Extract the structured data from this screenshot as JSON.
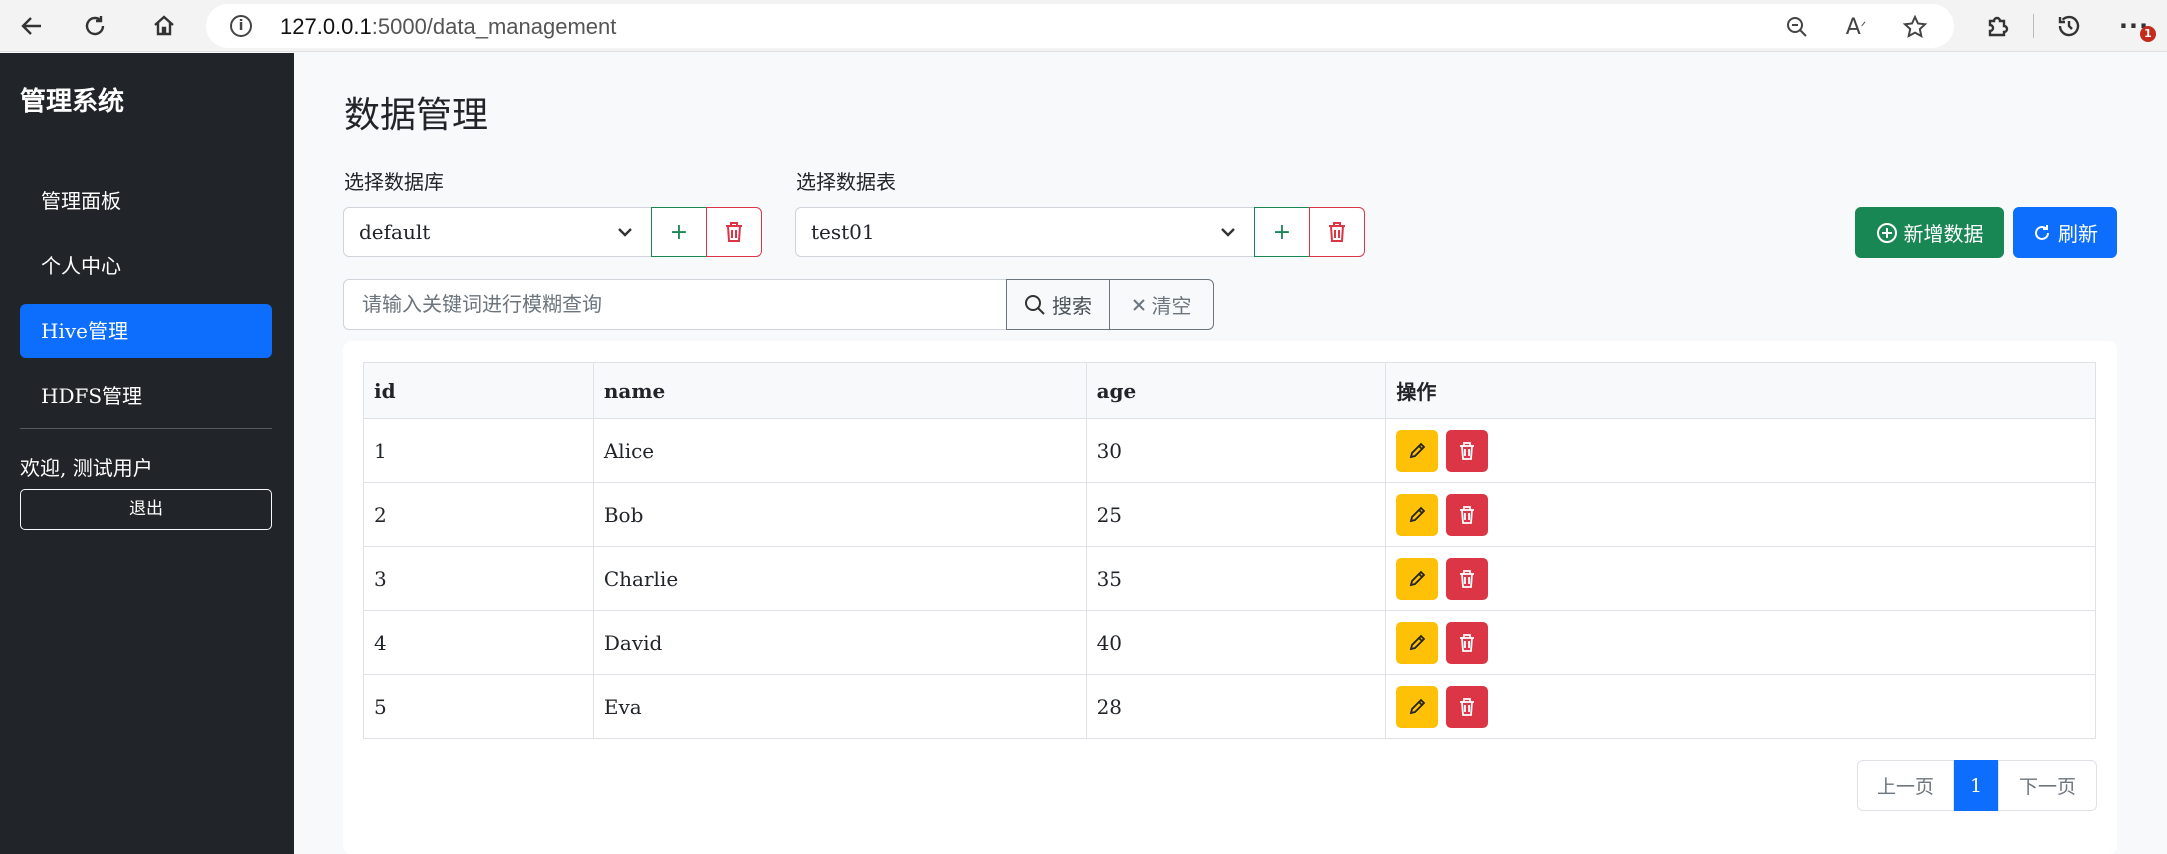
{
  "browser": {
    "url_host": "127.0.0.1",
    "url_rest": ":5000/data_management",
    "notification_count": "1"
  },
  "sidebar": {
    "brand": "管理系统",
    "items": [
      {
        "label": "管理面板",
        "active": false
      },
      {
        "label": "个人中心",
        "active": false
      },
      {
        "label": "Hive管理",
        "active": true
      },
      {
        "label": "HDFS管理",
        "active": false
      }
    ],
    "welcome": "欢迎, 测试用户",
    "logout": "退出"
  },
  "main": {
    "title": "数据管理",
    "database_label": "选择数据库",
    "database_value": "default",
    "table_label": "选择数据表",
    "table_value": "test01",
    "add_symbol": "+",
    "add_data_button": "新增数据",
    "refresh_button": "刷新",
    "search_placeholder": "请输入关键词进行模糊查询",
    "search_button": "搜索",
    "clear_button": "清空"
  },
  "table": {
    "columns": [
      "id",
      "name",
      "age",
      "操作"
    ],
    "rows": [
      [
        "1",
        "Alice",
        "30"
      ],
      [
        "2",
        "Bob",
        "25"
      ],
      [
        "3",
        "Charlie",
        "35"
      ],
      [
        "4",
        "David",
        "40"
      ],
      [
        "5",
        "Eva",
        "28"
      ]
    ]
  },
  "pagination": {
    "prev": "上一页",
    "current": "1",
    "next": "下一页"
  },
  "colors": {
    "sidebar_bg": "#212529",
    "primary": "#0d6efd",
    "success": "#198754",
    "danger": "#dc3545",
    "warning": "#ffc107"
  },
  "icons": [
    "back-arrow-icon",
    "reload-icon",
    "home-icon",
    "info-icon",
    "zoom-out-icon",
    "read-aloud-icon",
    "favorite-star-icon",
    "extensions-icon",
    "history-icon",
    "more-icon",
    "chevron-down-icon",
    "plus-circle-icon",
    "refresh-icon",
    "search-icon",
    "close-icon",
    "pencil-icon",
    "trash-icon"
  ]
}
